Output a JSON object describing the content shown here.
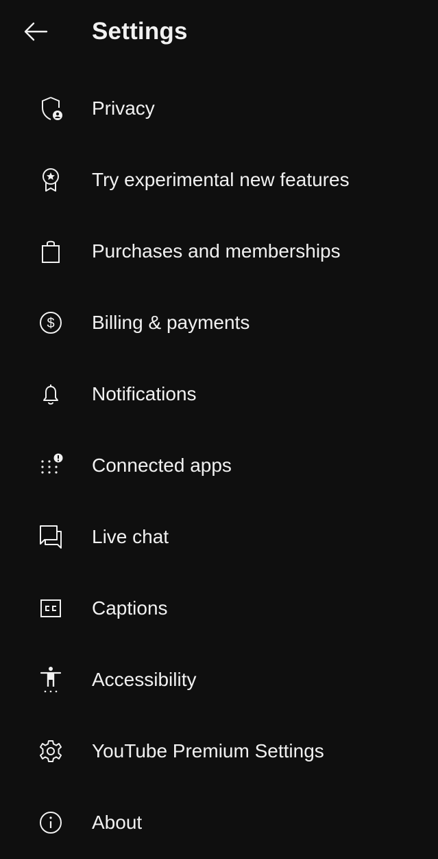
{
  "header": {
    "back_icon": "arrow-left-icon",
    "title": "Settings"
  },
  "menu": {
    "items": [
      {
        "id": "privacy",
        "label": "Privacy",
        "icon": "shield-person-icon"
      },
      {
        "id": "experimental",
        "label": "Try experimental new features",
        "icon": "award-badge-icon"
      },
      {
        "id": "purchases",
        "label": "Purchases and memberships",
        "icon": "shopping-bag-icon"
      },
      {
        "id": "billing",
        "label": "Billing & payments",
        "icon": "dollar-circle-icon"
      },
      {
        "id": "notifications",
        "label": "Notifications",
        "icon": "bell-icon"
      },
      {
        "id": "connected-apps",
        "label": "Connected apps",
        "icon": "dots-grid-alert-icon"
      },
      {
        "id": "live-chat",
        "label": "Live chat",
        "icon": "chat-bubbles-icon"
      },
      {
        "id": "captions",
        "label": "Captions",
        "icon": "closed-captions-icon"
      },
      {
        "id": "accessibility",
        "label": "Accessibility",
        "icon": "accessibility-person-icon"
      },
      {
        "id": "premium-settings",
        "label": "YouTube Premium Settings",
        "icon": "gear-icon"
      },
      {
        "id": "about",
        "label": "About",
        "icon": "info-circle-icon"
      }
    ]
  },
  "colors": {
    "background": "#0f0f0f",
    "text": "#f1f1f1"
  }
}
